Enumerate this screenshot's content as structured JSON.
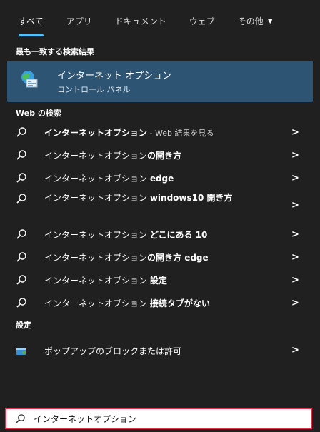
{
  "tabs": [
    {
      "label": "すべて",
      "active": true
    },
    {
      "label": "アプリ",
      "active": false
    },
    {
      "label": "ドキュメント",
      "active": false
    },
    {
      "label": "ウェブ",
      "active": false
    },
    {
      "label": "その他",
      "active": false
    }
  ],
  "tabs_more_chevron": "▼",
  "best_match": {
    "header": "最も一致する検索結果",
    "title": "インターネット オプション",
    "subtitle": "コントロール パネル",
    "icon": "internet-options-icon"
  },
  "web_search": {
    "header": "Web の検索",
    "items": [
      {
        "prefix": "インターネットオプション",
        "suffix": " - Web 結果を見る",
        "suffix_style": "dim"
      },
      {
        "prefix": "インターネットオプション",
        "suffix": "の開き方",
        "suffix_style": "bold"
      },
      {
        "prefix": "インターネットオプション ",
        "suffix": "edge",
        "suffix_style": "bold"
      },
      {
        "prefix": "インターネットオプション ",
        "suffix": "windows10 開き方",
        "suffix_style": "bold"
      },
      {
        "prefix": "インターネットオプション ",
        "suffix": "どこにある 10",
        "suffix_style": "bold"
      },
      {
        "prefix": "インターネットオプション",
        "suffix": "の開き方 edge",
        "suffix_style": "bold"
      },
      {
        "prefix": "インターネットオプション ",
        "suffix": "設定",
        "suffix_style": "bold"
      },
      {
        "prefix": "インターネットオプション ",
        "suffix": "接続タブがない",
        "suffix_style": "bold"
      }
    ],
    "arrow": ">"
  },
  "settings": {
    "header": "設定",
    "item_label": "ポップアップのブロックまたは許可",
    "arrow": ">",
    "icon": "settings-shield-icon"
  },
  "search": {
    "value": "インターネットオプション",
    "icon": "search-icon"
  },
  "colors": {
    "accent": "#4cc2ff",
    "best_match_bg": "#2d5472",
    "panel_bg": "#202020",
    "search_border": "#e0304b"
  }
}
